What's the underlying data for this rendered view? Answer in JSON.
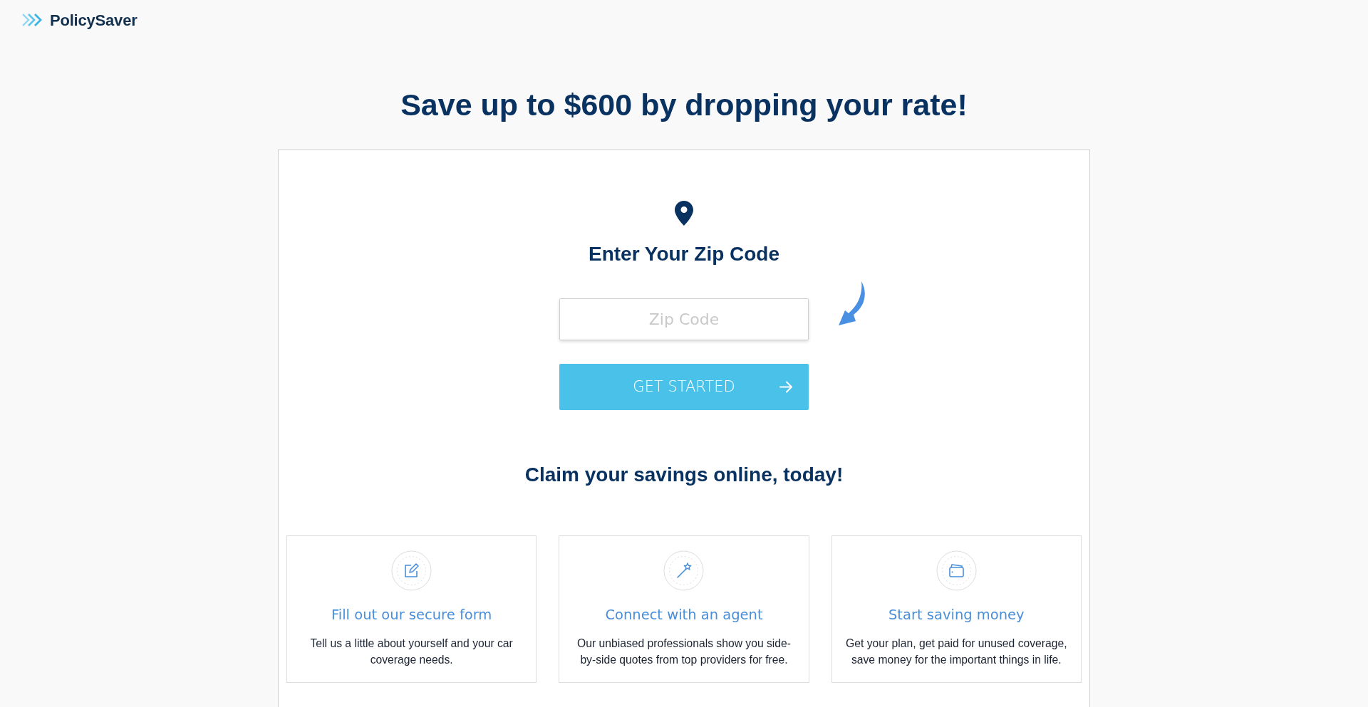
{
  "header": {
    "logo_text": "PolicySaver"
  },
  "headline": "Save up to $600 by dropping your rate!",
  "zip_form": {
    "title": "Enter Your Zip Code",
    "zip_field": {
      "placeholder": "Zip Code"
    },
    "button": "GET STARTED"
  },
  "subheading": "Claim your savings online, today!",
  "features": [
    {
      "title": "Fill out our secure form",
      "text": "Tell us a little about yourself and your car coverage needs."
    },
    {
      "title": "Connect with an agent",
      "text": "Our unbiased professionals show you side-by-side quotes from top providers for free."
    },
    {
      "title": "Start saving money",
      "text": "Get your plan, get paid for unused coverage, save money for the important things in life."
    }
  ]
}
